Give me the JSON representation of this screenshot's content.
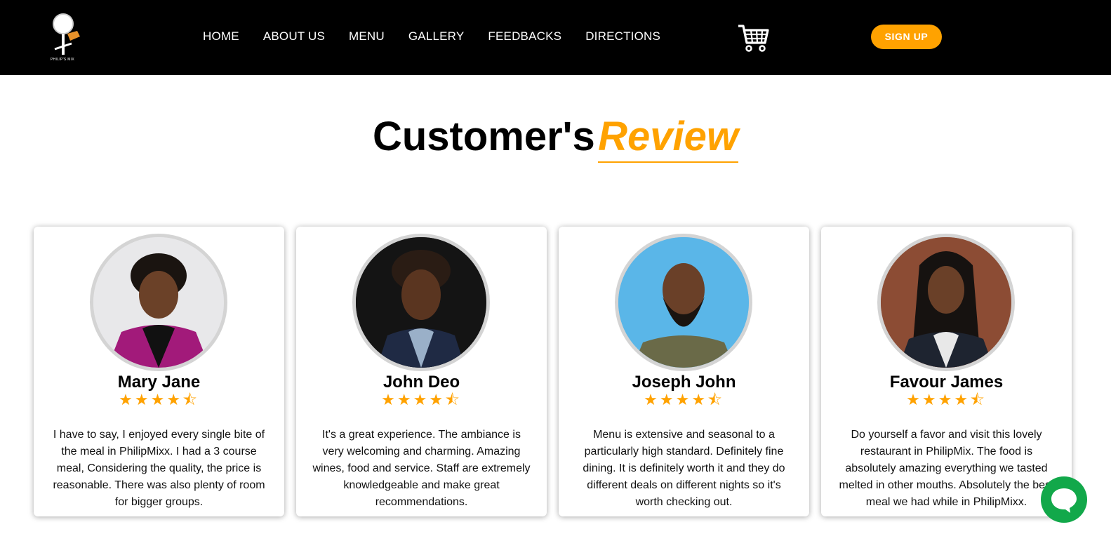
{
  "header": {
    "logo_text": "PHILIP'S MIX",
    "nav": [
      "HOME",
      "ABOUT US",
      "MENU",
      "GALLERY",
      "FEEDBACKS",
      "DIRECTIONS"
    ],
    "cart_icon": "shopping-cart-icon",
    "signup_label": "SIGN UP"
  },
  "title": {
    "part1": "Customer's",
    "part2": "Review"
  },
  "reviews": [
    {
      "name": "Mary Jane",
      "rating": 4.5,
      "text": "I have to say, I enjoyed every single bite of the meal in PhilipMixx. I had a 3 course meal, Considering the quality, the price is reasonable. There was also plenty of room for bigger groups."
    },
    {
      "name": "John Deo",
      "rating": 4.5,
      "text": "It's a great experience. The ambiance is very welcoming and charming. Amazing wines, food and service. Staff are extremely knowledgeable and make great recommendations."
    },
    {
      "name": "Joseph John",
      "rating": 4.5,
      "text": "Menu is extensive and seasonal to a particularly high standard. Definitely fine dining. It is definitely worth it and they do different deals on different nights so it's worth checking out."
    },
    {
      "name": "Favour James",
      "rating": 4.5,
      "text": "Do yourself a favor and visit this lovely restaurant in PhilipMix. The food is absolutely amazing everything we tasted melted in other mouths. Absolutely the best meal we had while in PhilipMixx."
    }
  ],
  "colors": {
    "accent": "#ffa200",
    "header_bg": "#000000",
    "chat": "#12a84a"
  },
  "chat_icon": "chat-bubble-icon"
}
